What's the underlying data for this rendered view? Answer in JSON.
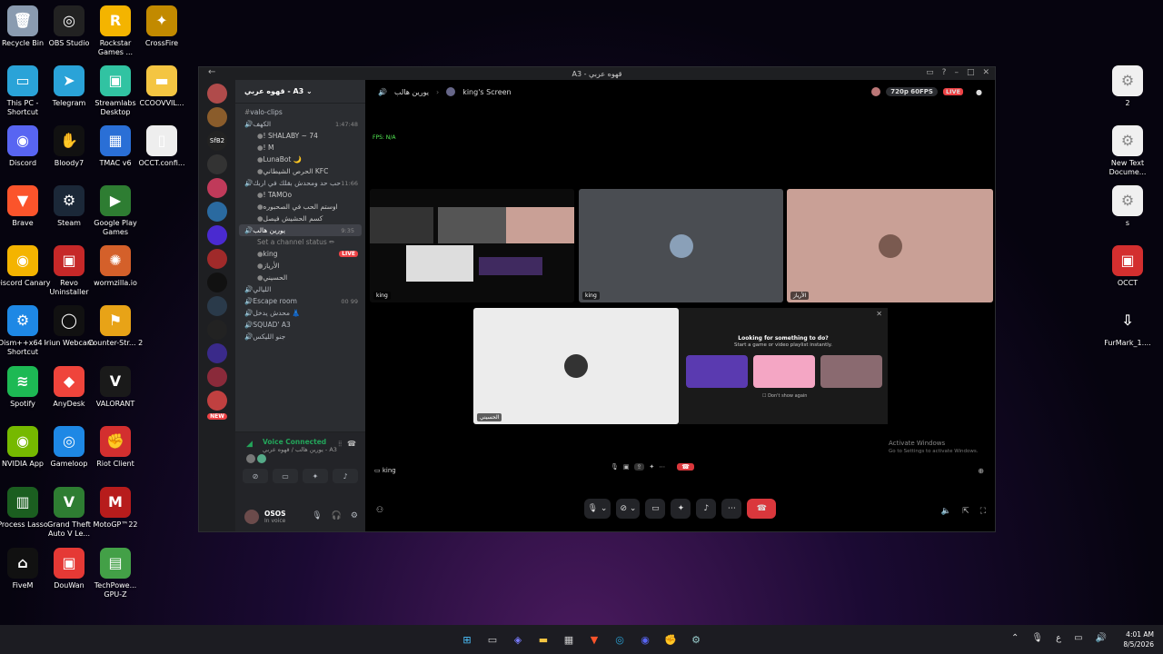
{
  "desktop_left": [
    {
      "label": "Recycle Bin",
      "icon": "recycle-bin-icon",
      "color": "#8a9bb0",
      "glyph": "🗑"
    },
    {
      "label": "OBS Studio",
      "icon": "obs-icon",
      "color": "#222",
      "glyph": "◎"
    },
    {
      "label": "Rockstar Games ...",
      "icon": "rockstar-icon",
      "color": "#f4b400",
      "glyph": "R"
    },
    {
      "label": "CrossFire",
      "icon": "crossfire-icon",
      "color": "#c28a00",
      "glyph": "✦"
    },
    {
      "label": "This PC - Shortcut",
      "icon": "this-pc-icon",
      "color": "#2aa3d8",
      "glyph": "▭"
    },
    {
      "label": "Telegram",
      "icon": "telegram-icon",
      "color": "#2aa3d8",
      "glyph": "➤"
    },
    {
      "label": "Streamlabs Desktop",
      "icon": "streamlabs-icon",
      "color": "#31c3a2",
      "glyph": "▣"
    },
    {
      "label": "CCOOVVIL...",
      "icon": "folder-icon",
      "color": "#f4c542",
      "glyph": "▬"
    },
    {
      "label": "Discord",
      "icon": "discord-icon",
      "color": "#5865f2",
      "glyph": "◉"
    },
    {
      "label": "Bloody7",
      "icon": "bloody-icon",
      "color": "#111",
      "glyph": "✋"
    },
    {
      "label": "TMAC v6",
      "icon": "tmac-icon",
      "color": "#2a6fd6",
      "glyph": "▦"
    },
    {
      "label": "OCCT.confi...",
      "icon": "file-icon",
      "color": "#eeeeee",
      "glyph": "▯"
    },
    {
      "label": "Brave",
      "icon": "brave-icon",
      "color": "#fb542b",
      "glyph": "▼"
    },
    {
      "label": "Steam",
      "icon": "steam-icon",
      "color": "#1b2838",
      "glyph": "⚙"
    },
    {
      "label": "Google Play Games",
      "icon": "google-play-icon",
      "color": "#2e7d32",
      "glyph": "▶"
    },
    {
      "label": "Discord Canary",
      "icon": "discord-canary-icon",
      "color": "#f4b400",
      "glyph": "◉"
    },
    {
      "label": "Revo Uninstaller",
      "icon": "revo-icon",
      "color": "#c62828",
      "glyph": "▣"
    },
    {
      "label": "wormzilla.io",
      "icon": "wormzilla-icon",
      "color": "#d4602a",
      "glyph": "✺"
    },
    {
      "label": "Dism++x64 - Shortcut",
      "icon": "dism-icon",
      "color": "#1e88e5",
      "glyph": "⚙"
    },
    {
      "label": "Iriun Webcam",
      "icon": "iriun-icon",
      "color": "#111",
      "glyph": "◯"
    },
    {
      "label": "Counter-Str... 2",
      "icon": "cs2-icon",
      "color": "#e8a317",
      "glyph": "⚑"
    },
    {
      "label": "Spotify",
      "icon": "spotify-icon",
      "color": "#1db954",
      "glyph": "≋"
    },
    {
      "label": "AnyDesk",
      "icon": "anydesk-icon",
      "color": "#ef443b",
      "glyph": "◆"
    },
    {
      "label": "VALORANT",
      "icon": "valorant-icon",
      "color": "#1a1a1a",
      "glyph": "V"
    },
    {
      "label": "NVIDIA App",
      "icon": "nvidia-icon",
      "color": "#76b900",
      "glyph": "◉"
    },
    {
      "label": "Gameloop",
      "icon": "gameloop-icon",
      "color": "#1e88e5",
      "glyph": "◎"
    },
    {
      "label": "Riot Client",
      "icon": "riot-icon",
      "color": "#d32f2f",
      "glyph": "✊"
    },
    {
      "label": "Process Lasso",
      "icon": "process-lasso-icon",
      "color": "#1b5e20",
      "glyph": "▥"
    },
    {
      "label": "Grand Theft Auto V Le...",
      "icon": "gta-icon",
      "color": "#2e7d32",
      "glyph": "V"
    },
    {
      "label": "MotoGP™22",
      "icon": "motogp-icon",
      "color": "#b71c1c",
      "glyph": "M"
    },
    {
      "label": "FiveM",
      "icon": "fivem-icon",
      "color": "#111",
      "glyph": "⌂"
    },
    {
      "label": "DouWan",
      "icon": "douwan-icon",
      "color": "#e53935",
      "glyph": "▣"
    },
    {
      "label": "TechPowe... GPU-Z",
      "icon": "gpuz-icon",
      "color": "#43a047",
      "glyph": "▤"
    }
  ],
  "desktop_right": [
    {
      "label": "2",
      "icon": "settings-file-icon"
    },
    {
      "label": "New Text Docume...",
      "icon": "settings-file-icon"
    },
    {
      "label": "s",
      "icon": "settings-file-icon"
    },
    {
      "label": "OCCT",
      "icon": "occt-icon"
    },
    {
      "label": "FurMark_1....",
      "icon": "download-icon"
    }
  ],
  "window": {
    "title": "A3 - قهوه عربي",
    "server_name": "قهوه عربي - A3",
    "channels": [
      {
        "type": "text",
        "name": "valo-clips"
      },
      {
        "type": "voice",
        "name": "الكهف",
        "meta": "1:47:48"
      },
      {
        "type": "user",
        "name": "! SHALABY ~ 74"
      },
      {
        "type": "user",
        "name": "! M"
      },
      {
        "type": "user",
        "name": "LunaBot 🌙"
      },
      {
        "type": "user",
        "name": "الحرص الشيطاني KFC"
      },
      {
        "type": "voice",
        "name": "حب حد ومحدش بقلك في اربك",
        "meta": "11:66"
      },
      {
        "type": "user",
        "name": "! TAMOo"
      },
      {
        "type": "user",
        "name": "اوستم الحب في الصحبوره"
      },
      {
        "type": "user",
        "name": "كسم الحشيش فيصل"
      },
      {
        "type": "voice-active",
        "name": "يورين هالب",
        "meta": "9:35"
      },
      {
        "type": "status",
        "name": "Set a channel status ✏"
      },
      {
        "type": "user-live",
        "name": "king",
        "live": "LIVE"
      },
      {
        "type": "user",
        "name": "الأرياز"
      },
      {
        "type": "user",
        "name": "الحسيني"
      },
      {
        "type": "voice",
        "name": "الليالي"
      },
      {
        "type": "voice",
        "name": "Escape room",
        "meta": "00 99"
      },
      {
        "type": "voice",
        "name": "محدش يدخل 👗"
      },
      {
        "type": "voice",
        "name": "SQUAD' A3"
      },
      {
        "type": "voice",
        "name": "جنو الليكس"
      }
    ],
    "voice_connected": "Voice Connected",
    "voice_channel": "يورين هالب / قهوه عربي - A3",
    "user": {
      "name": "OSOS",
      "status": "In voice"
    },
    "new_badge": "NEW",
    "stage": {
      "channel": "يورين هالب",
      "screen_label": "king's Screen",
      "quality": "720p 60FPS",
      "live": "LIVE",
      "fps_text": "FPS: N/A",
      "tiles": [
        {
          "name": "king"
        },
        {
          "name": "king"
        },
        {
          "name": "الأرياز"
        },
        {
          "name": "الحسيني"
        }
      ],
      "popup_title": "Looking for something to do?",
      "popup_sub": "Start a game or video playlist instantly.",
      "popup_check": "Don't show again",
      "activate": "Activate Windows",
      "activate_sub": "Go to Settings to activate Windows.",
      "king_label": "king"
    }
  },
  "taskbar": {
    "time": "4:01 AM",
    "date": "8/5/2026",
    "lang": "ع"
  }
}
